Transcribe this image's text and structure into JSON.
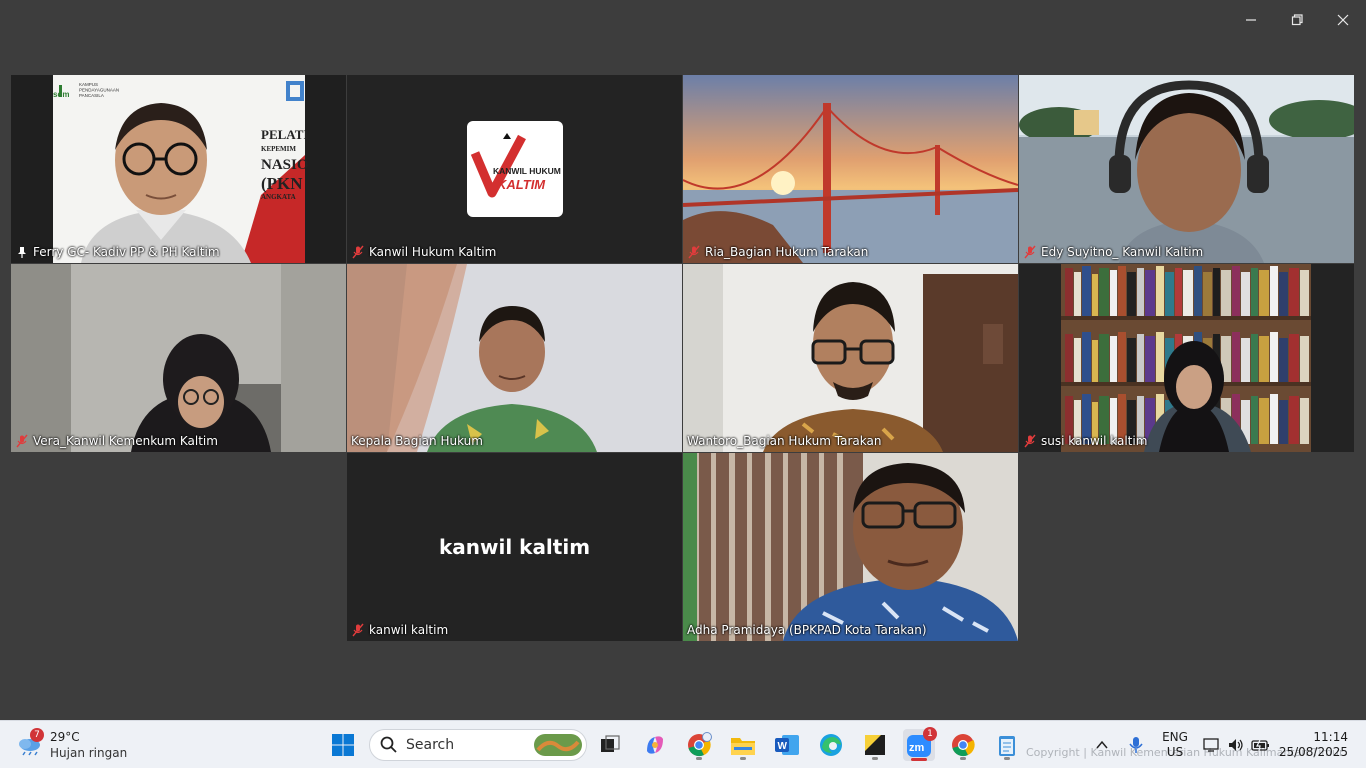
{
  "window": {
    "controls": [
      "minimize",
      "restore",
      "close"
    ]
  },
  "participants": [
    {
      "name": "Ferry GC- Kadiv PP & PH Kaltim",
      "muted": false,
      "active": true
    },
    {
      "name": "Kanwil Hukum Kaltim",
      "muted": true,
      "logo_text": "KANWIL HUKUM",
      "logo_text2": "KALTIM"
    },
    {
      "name": "Ria_Bagian Hukum Tarakan",
      "muted": true
    },
    {
      "name": "Edy Suyitno_ Kanwil Kaltim",
      "muted": true
    },
    {
      "name": "Vera_Kanwil Kemenkum Kaltim",
      "muted": true
    },
    {
      "name": "Kepala Bagian Hukum",
      "muted": false
    },
    {
      "name": "Wantoro_Bagian Hukum Tarakan",
      "muted": false
    },
    {
      "name": "susi kanwil kaltim",
      "muted": true
    },
    {
      "name": "kanwil kaltim",
      "muted": true,
      "video_off": true
    },
    {
      "name": "Adha Pramidaya (BPKPAD Kota Tarakan)",
      "muted": false
    }
  ],
  "tile1_banner": {
    "logo_line1": "KAMPUS",
    "logo_line2": "PENDAYAGUNAAN",
    "logo_line3": "PANCASILA",
    "brand": "sdm",
    "text1": "PELATI",
    "text2": "KEPEMIM",
    "text3": "NASIO",
    "text4": "(PKN",
    "text5": "ANGKATA"
  },
  "taskbar": {
    "weather": {
      "temp": "29°C",
      "desc": "Hujan ringan",
      "badge": "7"
    },
    "search_placeholder": "Search",
    "zoom_badge": "1",
    "lang_line1": "ENG",
    "lang_line2": "US",
    "time": "11:14",
    "date": "25/08/2025",
    "watermark": "Copyright | Kanwil Kementerian Hukum Kalimantan Timur"
  },
  "colors": {
    "active_border": "#2fd47d",
    "muted_mic": "#e03c3c",
    "taskbar_bg": "#eef1f6",
    "background": "#3d3d3d"
  }
}
